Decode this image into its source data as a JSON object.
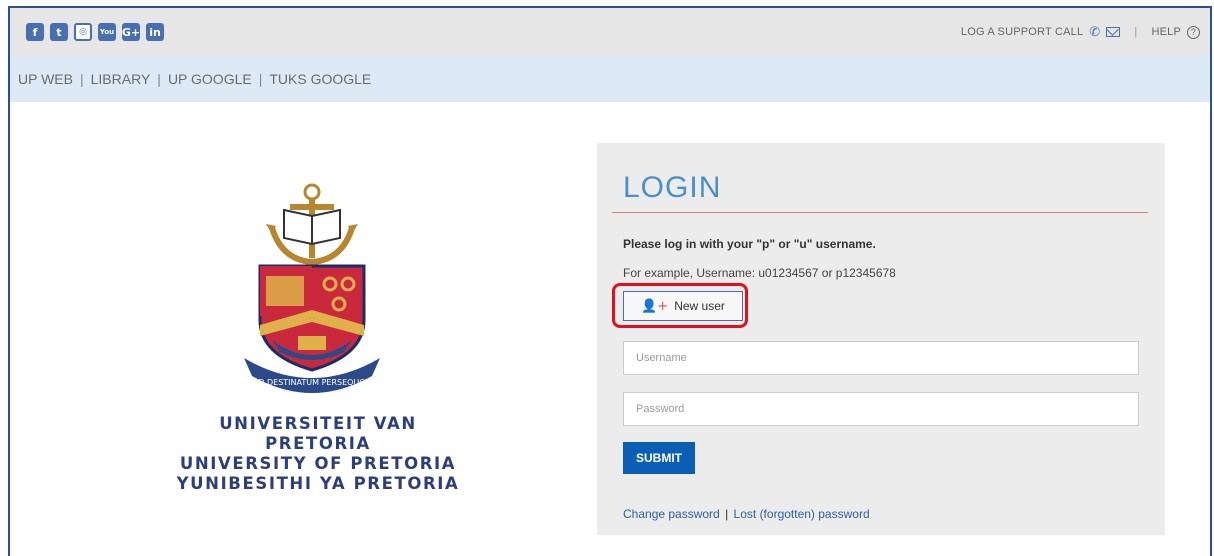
{
  "social": [
    {
      "name": "facebook-icon",
      "glyph": "f",
      "class": ""
    },
    {
      "name": "twitter-icon",
      "glyph": "t",
      "class": ""
    },
    {
      "name": "instagram-icon",
      "glyph": "◎",
      "class": "ig"
    },
    {
      "name": "youtube-icon",
      "glyph": "You",
      "class": "yt"
    },
    {
      "name": "googleplus-icon",
      "glyph": "G+",
      "class": ""
    },
    {
      "name": "linkedin-icon",
      "glyph": "in",
      "class": ""
    }
  ],
  "topbar": {
    "support": "LOG A SUPPORT CALL",
    "separator": "|",
    "help": "HELP"
  },
  "nav": {
    "items": [
      "UP WEB",
      "LIBRARY",
      "UP GOOGLE",
      "TUKS GOOGLE"
    ],
    "separator": "|"
  },
  "university": {
    "line1": "UNIVERSITEIT VAN PRETORIA",
    "line2": "UNIVERSITY OF PRETORIA",
    "line3": "YUNIBESITHI YA PRETORIA",
    "motto": "AD DESTINATUM PERSEQUOR"
  },
  "login": {
    "title": "LOGIN",
    "instruction": "Please log in with your \"p\" or \"u\" username.",
    "example": "For example, Username: u01234567 or p12345678",
    "new_user": "New user",
    "username_placeholder": "Username",
    "password_placeholder": "Password",
    "submit": "SUBMIT",
    "change_password": "Change password",
    "link_separator": "|",
    "lost_password": "Lost (forgotten) password"
  },
  "colors": {
    "accent": "#0a5fb4",
    "title": "#4a90c8",
    "highlight": "#e0101e",
    "nav_bg": "#ddeaf5",
    "topbar_bg": "#e6e6e6"
  }
}
